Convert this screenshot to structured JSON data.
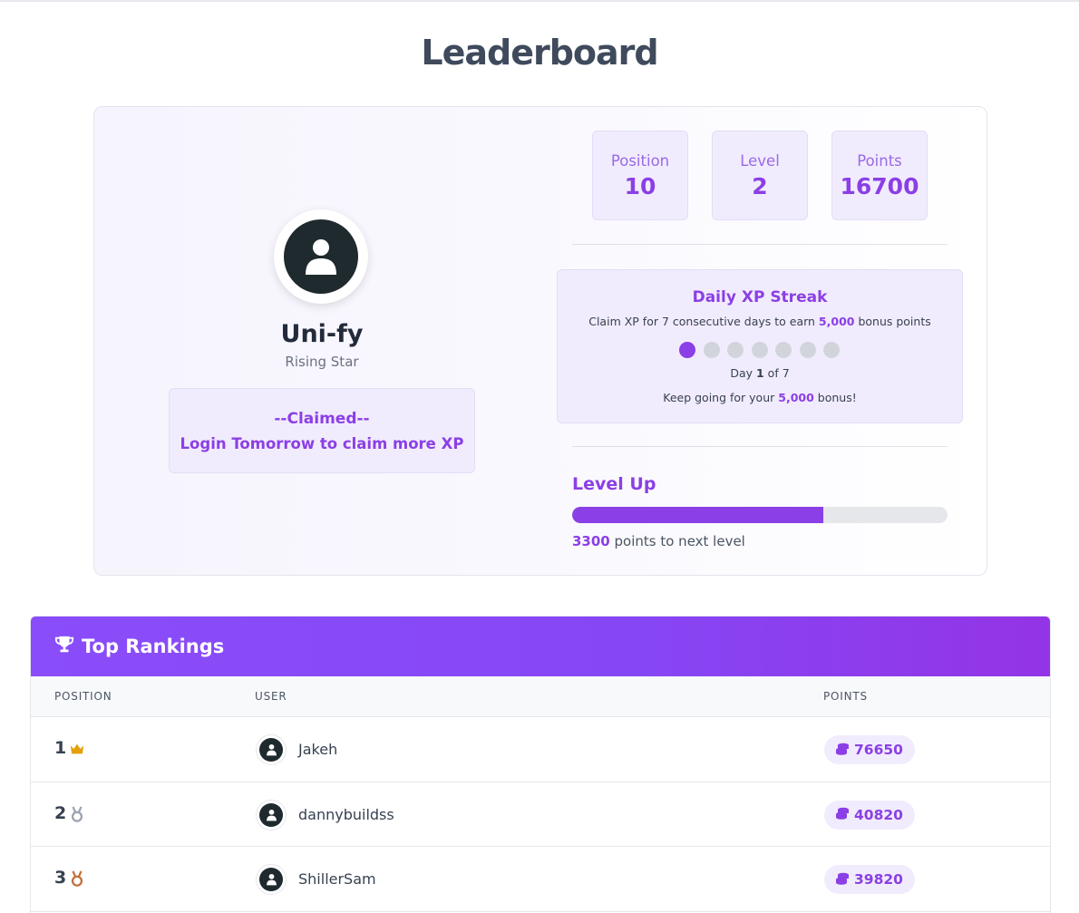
{
  "page": {
    "title": "Leaderboard"
  },
  "profile": {
    "username": "Uni-fy",
    "rank_title": "Rising Star",
    "claim_status": "--Claimed--",
    "claim_message": "Login Tomorrow to claim more XP"
  },
  "stats": [
    {
      "label": "Position",
      "value": "10"
    },
    {
      "label": "Level",
      "value": "2"
    },
    {
      "label": "Points",
      "value": "16700"
    }
  ],
  "streak": {
    "title": "Daily XP Streak",
    "desc_prefix": "Claim XP for 7 consecutive days to earn ",
    "bonus": "5,000",
    "desc_suffix": " bonus points",
    "days_total": 7,
    "days_done": 1,
    "day_prefix": "Day ",
    "day_current": "1",
    "day_suffix": " of 7",
    "keep_prefix": "Keep going for your ",
    "keep_suffix": " bonus!"
  },
  "level_up": {
    "title": "Level Up",
    "progress_fraction": 0.67,
    "points_needed": "3300",
    "points_suffix": " points to next level"
  },
  "rankings": {
    "title": "Top Rankings",
    "columns": {
      "position": "POSITION",
      "user": "USER",
      "points": "POINTS"
    },
    "rows": [
      {
        "position": "1",
        "medal": "crown-icon",
        "user": "Jakeh",
        "points": "76650"
      },
      {
        "position": "2",
        "medal": "silver-medal-icon",
        "user": "dannybuildss",
        "points": "40820"
      },
      {
        "position": "3",
        "medal": "bronze-medal-icon",
        "user": "ShillerSam",
        "points": "39820"
      }
    ]
  },
  "colors": {
    "accent": "#8b3fe6",
    "accent_soft": "#f1ecfd",
    "gold": "#e3a008",
    "silver": "#9ca3af",
    "bronze": "#c2703d"
  }
}
